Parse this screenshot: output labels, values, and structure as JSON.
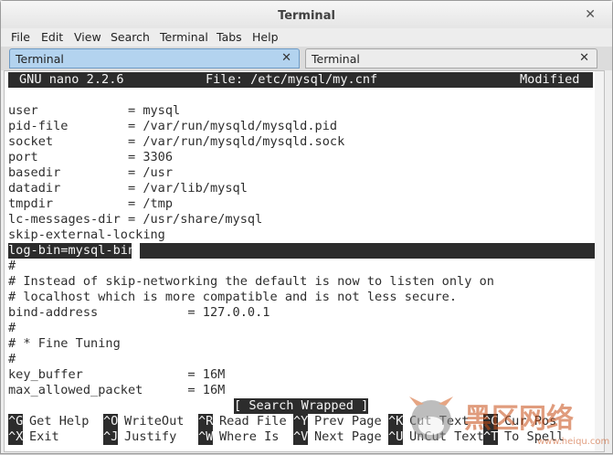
{
  "window": {
    "title": "Terminal"
  },
  "menu": [
    "File",
    "Edit",
    "View",
    "Search",
    "Terminal",
    "Tabs",
    "Help"
  ],
  "tabs": [
    {
      "label": "Terminal",
      "active": true
    },
    {
      "label": "Terminal",
      "active": false
    }
  ],
  "nano": {
    "version": "GNU nano 2.2.6",
    "file": "File: /etc/mysql/my.cnf",
    "state": "Modified",
    "lines": [
      "",
      "user            = mysql",
      "pid-file        = /var/run/mysqld/mysqld.pid",
      "socket          = /var/run/mysqld/mysqld.sock",
      "port            = 3306",
      "basedir         = /usr",
      "datadir         = /var/lib/mysql",
      "tmpdir          = /tmp",
      "lc-messages-dir = /usr/share/mysql",
      "skip-external-locking",
      "log-bin=mysql-bin",
      "#",
      "# Instead of skip-networking the default is now to listen only on",
      "# localhost which is more compatible and is not less secure.",
      "bind-address            = 127.0.0.1",
      "#",
      "# * Fine Tuning",
      "#",
      "key_buffer              = 16M",
      "max_allowed_packet      = 16M"
    ],
    "status_message": "[ Search Wrapped ]",
    "shortcuts_row1": [
      {
        "key": "^G",
        "label": "Get Help"
      },
      {
        "key": "^O",
        "label": "WriteOut"
      },
      {
        "key": "^R",
        "label": "Read File"
      },
      {
        "key": "^Y",
        "label": "Prev Page"
      },
      {
        "key": "^K",
        "label": "Cut Text"
      },
      {
        "key": "^C",
        "label": "Cur Pos"
      }
    ],
    "shortcuts_row2": [
      {
        "key": "^X",
        "label": "Exit"
      },
      {
        "key": "^J",
        "label": "Justify"
      },
      {
        "key": "^W",
        "label": "Where Is"
      },
      {
        "key": "^V",
        "label": "Next Page"
      },
      {
        "key": "^U",
        "label": "UnCut Text"
      },
      {
        "key": "^T",
        "label": "To Spell"
      }
    ]
  },
  "watermark": {
    "text": "黑区网络",
    "sub": "www.heiqu.com"
  }
}
